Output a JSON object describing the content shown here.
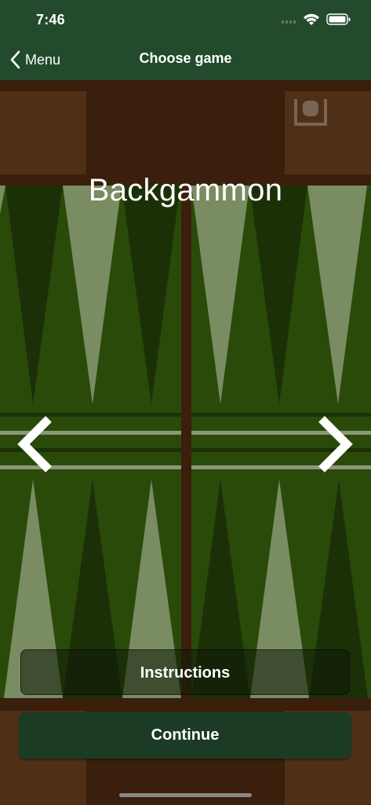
{
  "status_bar": {
    "time": "7:46",
    "icons": [
      "signal-icon",
      "wifi-icon",
      "battery-icon"
    ]
  },
  "nav": {
    "back_label": "Menu",
    "title": "Choose game"
  },
  "carousel": {
    "game_title": "Backgammon",
    "prev_icon": "chevron-left-icon",
    "next_icon": "chevron-right-icon"
  },
  "actions": {
    "instructions_label": "Instructions",
    "continue_label": "Continue"
  },
  "colors": {
    "nav_background": "#234a2c",
    "board_felt": "#2a4a0a",
    "board_frame": "#3a1f0c",
    "light_point": "#7a8c62",
    "dark_point": "#1c3008",
    "button_background": "#1c3b24"
  }
}
